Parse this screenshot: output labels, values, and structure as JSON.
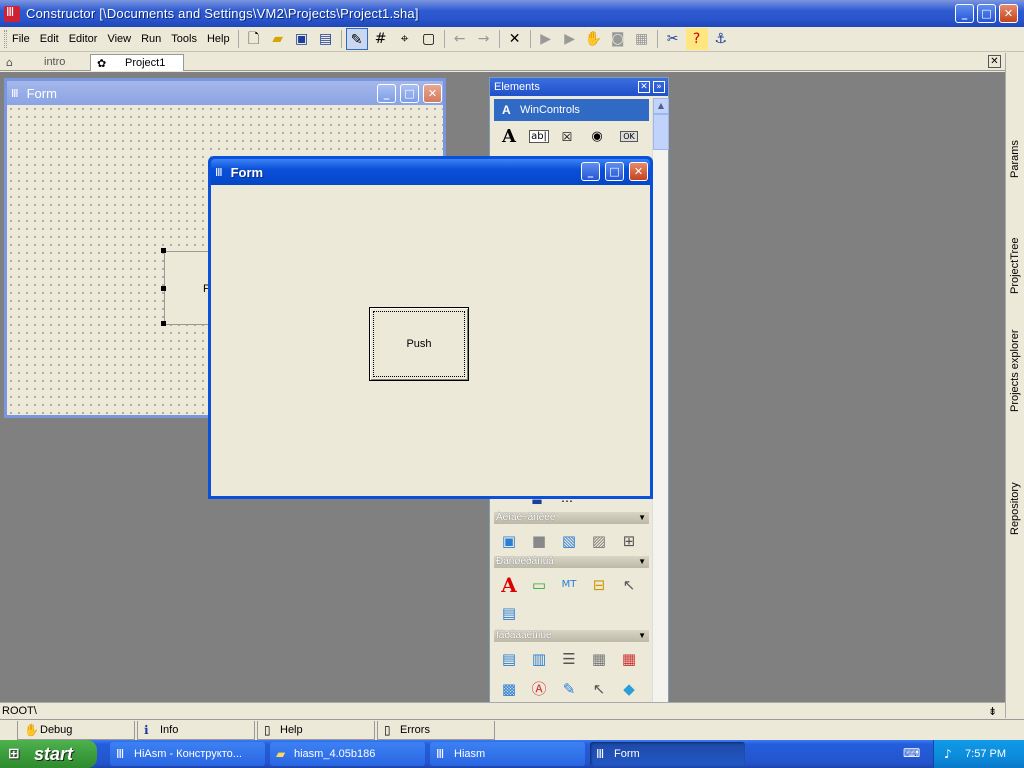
{
  "window": {
    "title": "Constructor [\\Documents and Settings\\VM2\\Projects\\Project1.sha]",
    "minimize": "_",
    "maximize": "□",
    "close": "✕"
  },
  "menu": [
    "File",
    "Edit",
    "Editor",
    "View",
    "Run",
    "Tools",
    "Help"
  ],
  "tabs": [
    {
      "label": "intro",
      "active": false
    },
    {
      "label": "Project1",
      "active": true
    }
  ],
  "right_tabs": [
    "Params",
    "ProjectTree",
    "Projects explorer",
    "Repository"
  ],
  "design_form": {
    "title": "Form",
    "button_text": "Po"
  },
  "elements_panel": {
    "title": "Elements",
    "group": "WinControls",
    "sections": [
      "Àëìàè÷âñêèé",
      "Ðàñøèðåííûå",
      "Ïåðåâàëüíûé"
    ]
  },
  "form_window": {
    "title": "Form",
    "button": "Push"
  },
  "status": {
    "path": "ROOT\\"
  },
  "bottom_tabs": [
    "Debug",
    "Info",
    "Help",
    "Errors"
  ],
  "taskbar": {
    "start": "start",
    "items": [
      {
        "label": "HiAsm - Конструкто...",
        "active": false
      },
      {
        "label": "hiasm_4.05b186",
        "active": false
      },
      {
        "label": "Hiasm",
        "active": false
      },
      {
        "label": "Form",
        "active": true
      }
    ],
    "clock": "7:57 PM"
  }
}
